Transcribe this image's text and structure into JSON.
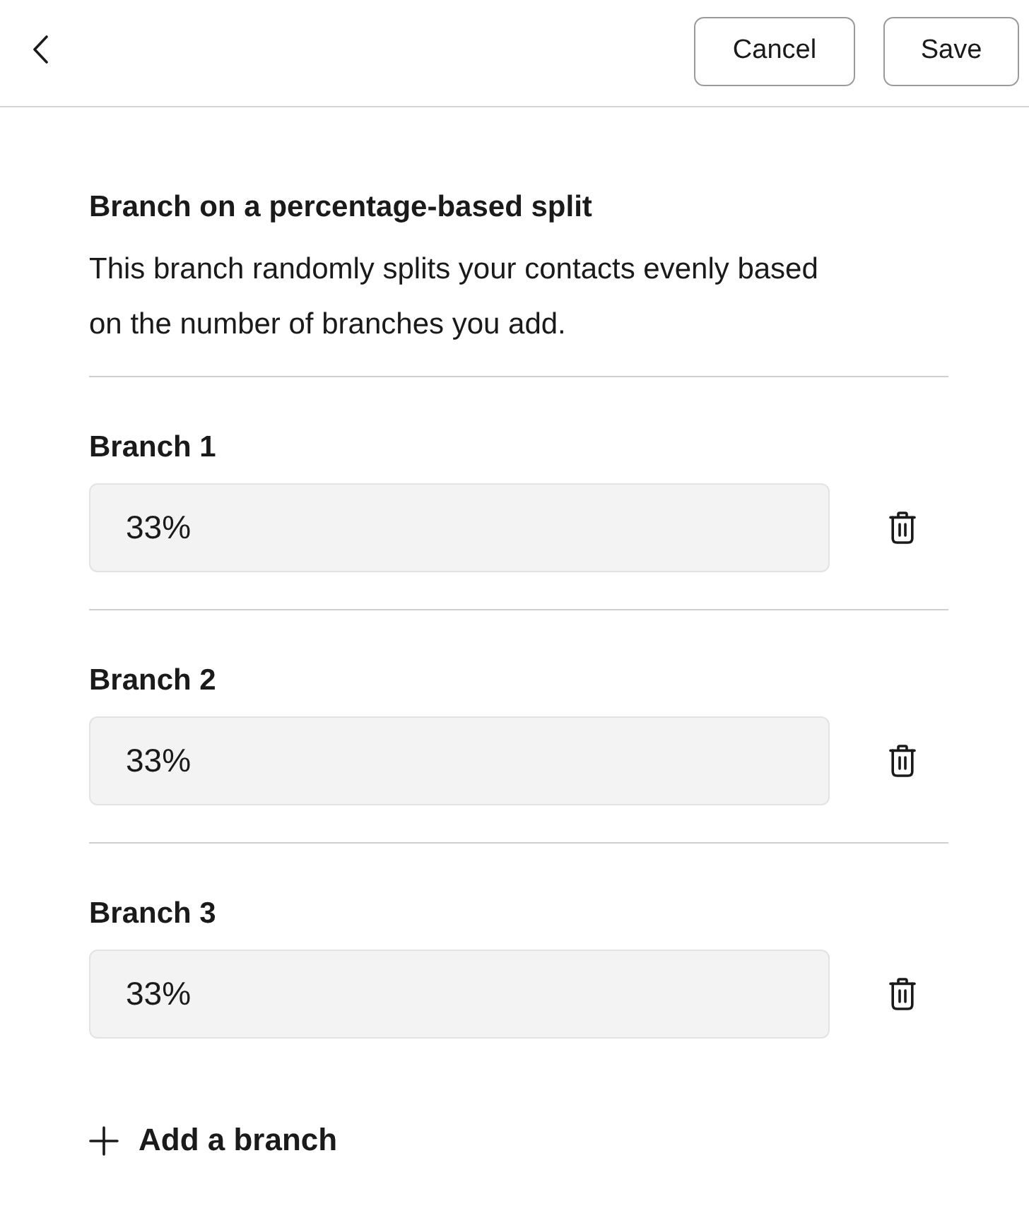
{
  "header": {
    "buttons": [
      {
        "label": "Cancel"
      },
      {
        "label": "Save"
      }
    ]
  },
  "title": "Branch on a percentage-based split",
  "description": "This branch randomly splits your contacts evenly based on the number of branches you add.",
  "branches": [
    {
      "label": "Branch 1",
      "value": "33%"
    },
    {
      "label": "Branch 2",
      "value": "33%"
    },
    {
      "label": "Branch 3",
      "value": "33%"
    }
  ],
  "add_button": {
    "label": "Add a branch"
  }
}
